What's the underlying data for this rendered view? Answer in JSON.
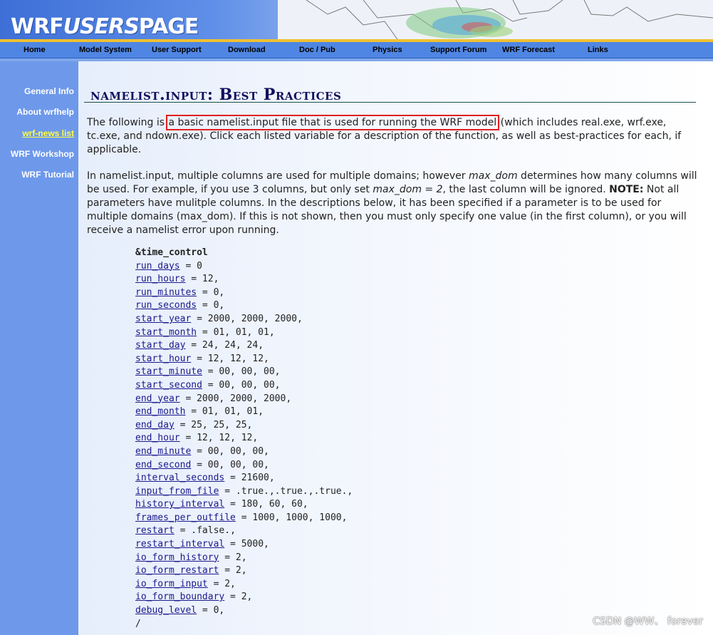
{
  "header": {
    "logo_wrf": "WRF",
    "logo_users": "USERS",
    "logo_page": "PAGE"
  },
  "nav": {
    "items": [
      "Home",
      "Model System",
      "User Support",
      "Download",
      "Doc / Pub",
      "Physics",
      "Support Forum",
      "WRF Forecast",
      "Links"
    ]
  },
  "sidebar": {
    "items": [
      {
        "label": "General Info",
        "active": false
      },
      {
        "label": "About wrfhelp",
        "active": false
      },
      {
        "label": "wrf-news list",
        "active": true
      },
      {
        "label": "WRF Workshop",
        "active": false
      },
      {
        "label": "WRF Tutorial",
        "active": false
      }
    ]
  },
  "main": {
    "title": "namelist.input: Best Practices",
    "intro_before": "The following is ",
    "intro_highlight": "a basic namelist.input file that is used for running the WRF model",
    "intro_after": " (which includes real.exe, wrf.exe, tc.exe, and ndown.exe). Click each listed variable for a description of the function, as well as best-practices for each, if applicable.",
    "para2_a": "In namelist.input, multiple columns are used for multiple domains; however ",
    "para2_maxdom": "max_dom",
    "para2_b": " determines how many columns will be used. For example, if you use 3 columns, but only set ",
    "para2_maxdom2": "max_dom = 2",
    "para2_c": ", the last column will be ignored. ",
    "para2_note": "NOTE:",
    "para2_d": " Not all parameters have mulitple columns. In the descriptions below, it has been specified if a parameter is to be used for multiple domains (max_dom). If this is not shown, then you must only specify one value (in the first column), or you will receive a namelist error upon running.",
    "section": "&time_control",
    "variables": [
      {
        "name": "run_days",
        "value": " = 0"
      },
      {
        "name": "run_hours",
        "value": " = 12,"
      },
      {
        "name": "run_minutes",
        "value": " = 0,"
      },
      {
        "name": "run_seconds",
        "value": " = 0,"
      },
      {
        "name": "start_year",
        "value": " = 2000, 2000, 2000,"
      },
      {
        "name": "start_month",
        "value": " = 01, 01, 01,"
      },
      {
        "name": "start_day",
        "value": " = 24, 24, 24,"
      },
      {
        "name": "start_hour",
        "value": " = 12, 12, 12,"
      },
      {
        "name": "start_minute",
        "value": " = 00, 00, 00,"
      },
      {
        "name": "start_second",
        "value": " = 00, 00, 00,"
      },
      {
        "name": "end_year",
        "value": " = 2000, 2000, 2000,"
      },
      {
        "name": "end_month",
        "value": " = 01, 01, 01,"
      },
      {
        "name": "end_day",
        "value": " = 25, 25, 25,"
      },
      {
        "name": "end_hour",
        "value": " = 12, 12, 12,"
      },
      {
        "name": "end_minute",
        "value": " = 00, 00, 00,"
      },
      {
        "name": "end_second",
        "value": " = 00, 00, 00,"
      },
      {
        "name": "interval_seconds",
        "value": " = 21600,"
      },
      {
        "name": "input_from_file",
        "value": " = .true.,.true.,.true.,"
      },
      {
        "name": "history_interval",
        "value": " = 180, 60, 60,"
      },
      {
        "name": "frames_per_outfile",
        "value": " = 1000, 1000, 1000,"
      },
      {
        "name": "restart",
        "value": " = .false.,"
      },
      {
        "name": "restart_interval",
        "value": " = 5000,"
      },
      {
        "name": "io_form_history",
        "value": " = 2,"
      },
      {
        "name": "io_form_restart",
        "value": " = 2,"
      },
      {
        "name": "io_form_input",
        "value": " = 2,"
      },
      {
        "name": "io_form_boundary",
        "value": " = 2,"
      },
      {
        "name": "debug_level",
        "value": " = 0,"
      }
    ],
    "section_end": "/"
  },
  "watermark": "CSDN @WW、 forever",
  "colors": {
    "nav_bg": "#4f86e3",
    "sidebar_bg": "#6e98ea",
    "accent_line": "#f0c030",
    "title": "#10105c",
    "highlight_box": "#e02020",
    "active_link": "#ffff44"
  }
}
